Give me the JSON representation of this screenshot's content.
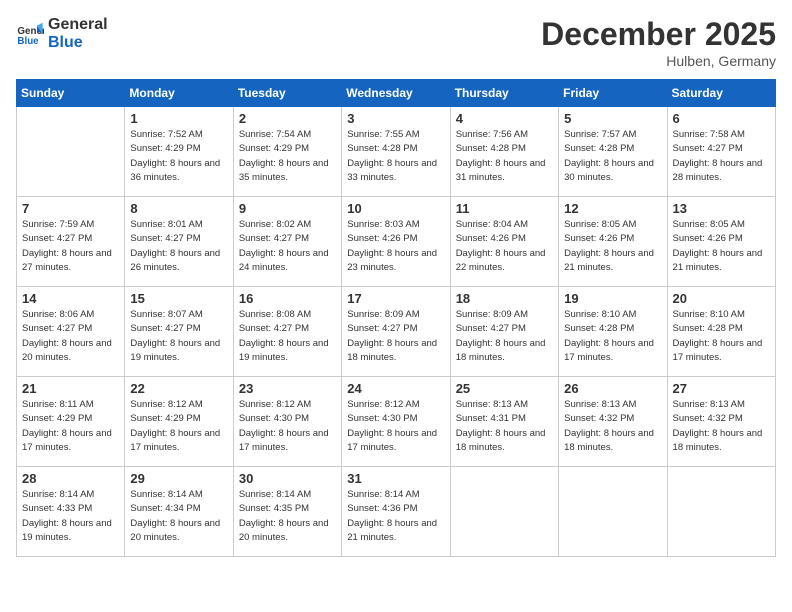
{
  "header": {
    "logo_general": "General",
    "logo_blue": "Blue",
    "month_year": "December 2025",
    "location": "Hulben, Germany"
  },
  "weekdays": [
    "Sunday",
    "Monday",
    "Tuesday",
    "Wednesday",
    "Thursday",
    "Friday",
    "Saturday"
  ],
  "weeks": [
    [
      {
        "day": "",
        "sunrise": "",
        "sunset": "",
        "daylight": ""
      },
      {
        "day": "1",
        "sunrise": "Sunrise: 7:52 AM",
        "sunset": "Sunset: 4:29 PM",
        "daylight": "Daylight: 8 hours and 36 minutes."
      },
      {
        "day": "2",
        "sunrise": "Sunrise: 7:54 AM",
        "sunset": "Sunset: 4:29 PM",
        "daylight": "Daylight: 8 hours and 35 minutes."
      },
      {
        "day": "3",
        "sunrise": "Sunrise: 7:55 AM",
        "sunset": "Sunset: 4:28 PM",
        "daylight": "Daylight: 8 hours and 33 minutes."
      },
      {
        "day": "4",
        "sunrise": "Sunrise: 7:56 AM",
        "sunset": "Sunset: 4:28 PM",
        "daylight": "Daylight: 8 hours and 31 minutes."
      },
      {
        "day": "5",
        "sunrise": "Sunrise: 7:57 AM",
        "sunset": "Sunset: 4:28 PM",
        "daylight": "Daylight: 8 hours and 30 minutes."
      },
      {
        "day": "6",
        "sunrise": "Sunrise: 7:58 AM",
        "sunset": "Sunset: 4:27 PM",
        "daylight": "Daylight: 8 hours and 28 minutes."
      }
    ],
    [
      {
        "day": "7",
        "sunrise": "Sunrise: 7:59 AM",
        "sunset": "Sunset: 4:27 PM",
        "daylight": "Daylight: 8 hours and 27 minutes."
      },
      {
        "day": "8",
        "sunrise": "Sunrise: 8:01 AM",
        "sunset": "Sunset: 4:27 PM",
        "daylight": "Daylight: 8 hours and 26 minutes."
      },
      {
        "day": "9",
        "sunrise": "Sunrise: 8:02 AM",
        "sunset": "Sunset: 4:27 PM",
        "daylight": "Daylight: 8 hours and 24 minutes."
      },
      {
        "day": "10",
        "sunrise": "Sunrise: 8:03 AM",
        "sunset": "Sunset: 4:26 PM",
        "daylight": "Daylight: 8 hours and 23 minutes."
      },
      {
        "day": "11",
        "sunrise": "Sunrise: 8:04 AM",
        "sunset": "Sunset: 4:26 PM",
        "daylight": "Daylight: 8 hours and 22 minutes."
      },
      {
        "day": "12",
        "sunrise": "Sunrise: 8:05 AM",
        "sunset": "Sunset: 4:26 PM",
        "daylight": "Daylight: 8 hours and 21 minutes."
      },
      {
        "day": "13",
        "sunrise": "Sunrise: 8:05 AM",
        "sunset": "Sunset: 4:26 PM",
        "daylight": "Daylight: 8 hours and 21 minutes."
      }
    ],
    [
      {
        "day": "14",
        "sunrise": "Sunrise: 8:06 AM",
        "sunset": "Sunset: 4:27 PM",
        "daylight": "Daylight: 8 hours and 20 minutes."
      },
      {
        "day": "15",
        "sunrise": "Sunrise: 8:07 AM",
        "sunset": "Sunset: 4:27 PM",
        "daylight": "Daylight: 8 hours and 19 minutes."
      },
      {
        "day": "16",
        "sunrise": "Sunrise: 8:08 AM",
        "sunset": "Sunset: 4:27 PM",
        "daylight": "Daylight: 8 hours and 19 minutes."
      },
      {
        "day": "17",
        "sunrise": "Sunrise: 8:09 AM",
        "sunset": "Sunset: 4:27 PM",
        "daylight": "Daylight: 8 hours and 18 minutes."
      },
      {
        "day": "18",
        "sunrise": "Sunrise: 8:09 AM",
        "sunset": "Sunset: 4:27 PM",
        "daylight": "Daylight: 8 hours and 18 minutes."
      },
      {
        "day": "19",
        "sunrise": "Sunrise: 8:10 AM",
        "sunset": "Sunset: 4:28 PM",
        "daylight": "Daylight: 8 hours and 17 minutes."
      },
      {
        "day": "20",
        "sunrise": "Sunrise: 8:10 AM",
        "sunset": "Sunset: 4:28 PM",
        "daylight": "Daylight: 8 hours and 17 minutes."
      }
    ],
    [
      {
        "day": "21",
        "sunrise": "Sunrise: 8:11 AM",
        "sunset": "Sunset: 4:29 PM",
        "daylight": "Daylight: 8 hours and 17 minutes."
      },
      {
        "day": "22",
        "sunrise": "Sunrise: 8:12 AM",
        "sunset": "Sunset: 4:29 PM",
        "daylight": "Daylight: 8 hours and 17 minutes."
      },
      {
        "day": "23",
        "sunrise": "Sunrise: 8:12 AM",
        "sunset": "Sunset: 4:30 PM",
        "daylight": "Daylight: 8 hours and 17 minutes."
      },
      {
        "day": "24",
        "sunrise": "Sunrise: 8:12 AM",
        "sunset": "Sunset: 4:30 PM",
        "daylight": "Daylight: 8 hours and 17 minutes."
      },
      {
        "day": "25",
        "sunrise": "Sunrise: 8:13 AM",
        "sunset": "Sunset: 4:31 PM",
        "daylight": "Daylight: 8 hours and 18 minutes."
      },
      {
        "day": "26",
        "sunrise": "Sunrise: 8:13 AM",
        "sunset": "Sunset: 4:32 PM",
        "daylight": "Daylight: 8 hours and 18 minutes."
      },
      {
        "day": "27",
        "sunrise": "Sunrise: 8:13 AM",
        "sunset": "Sunset: 4:32 PM",
        "daylight": "Daylight: 8 hours and 18 minutes."
      }
    ],
    [
      {
        "day": "28",
        "sunrise": "Sunrise: 8:14 AM",
        "sunset": "Sunset: 4:33 PM",
        "daylight": "Daylight: 8 hours and 19 minutes."
      },
      {
        "day": "29",
        "sunrise": "Sunrise: 8:14 AM",
        "sunset": "Sunset: 4:34 PM",
        "daylight": "Daylight: 8 hours and 20 minutes."
      },
      {
        "day": "30",
        "sunrise": "Sunrise: 8:14 AM",
        "sunset": "Sunset: 4:35 PM",
        "daylight": "Daylight: 8 hours and 20 minutes."
      },
      {
        "day": "31",
        "sunrise": "Sunrise: 8:14 AM",
        "sunset": "Sunset: 4:36 PM",
        "daylight": "Daylight: 8 hours and 21 minutes."
      },
      {
        "day": "",
        "sunrise": "",
        "sunset": "",
        "daylight": ""
      },
      {
        "day": "",
        "sunrise": "",
        "sunset": "",
        "daylight": ""
      },
      {
        "day": "",
        "sunrise": "",
        "sunset": "",
        "daylight": ""
      }
    ]
  ]
}
